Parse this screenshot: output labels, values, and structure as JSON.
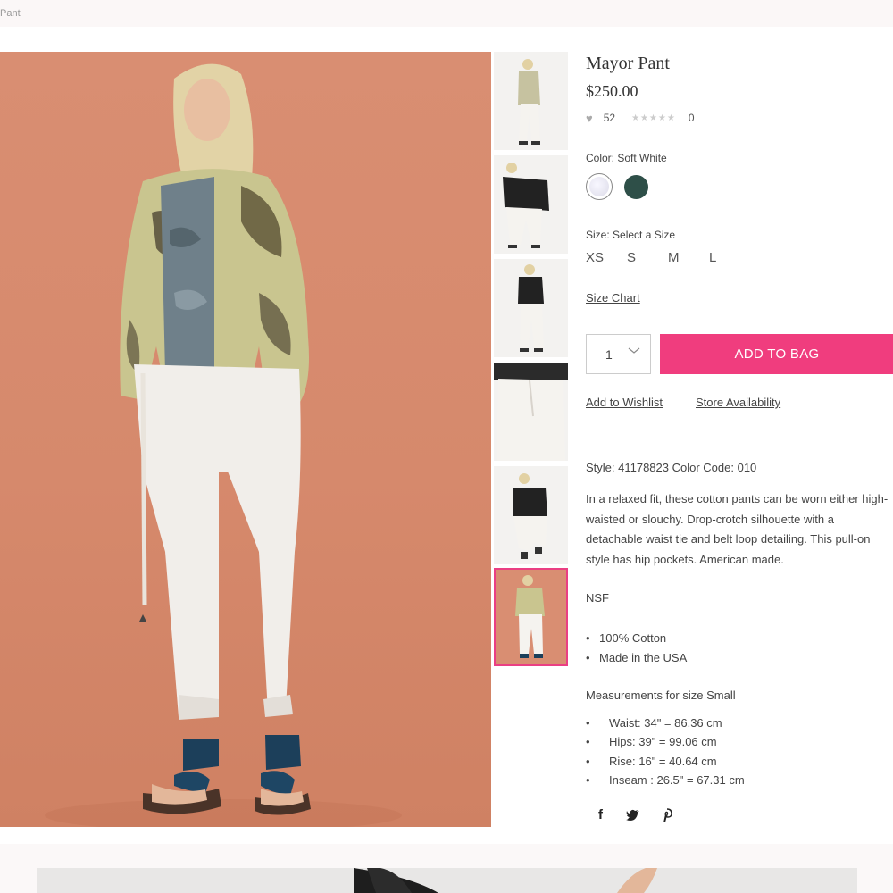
{
  "breadcrumb": "Pant",
  "product": {
    "title": "Mayor Pant",
    "price": "$250.00",
    "likes": "52",
    "rating_count": "0",
    "rating_stars": "★★★★★"
  },
  "color": {
    "label": "Color: Soft White",
    "options": [
      "soft-white",
      "forest-green"
    ]
  },
  "size": {
    "label": "Size: Select a Size",
    "options": [
      "XS",
      "S",
      "M",
      "L"
    ],
    "chart_link": "Size Chart"
  },
  "quantity": {
    "value": "1"
  },
  "actions": {
    "add_to_bag": "ADD TO BAG",
    "wishlist": "Add to Wishlist",
    "store_availability": "Store Availability"
  },
  "details": {
    "style": "Style: 41178823 Color Code: 010",
    "description": "In a relaxed fit, these cotton pants can be worn either high-waisted or slouchy. Drop-crotch silhouette with a detachable waist tie and belt loop detailing. This pull-on style has hip pockets. American made.",
    "brand_code": "NSF",
    "features": [
      "100% Cotton",
      "Made in the USA"
    ],
    "measurements_title": "Measurements for size Small",
    "measurements": [
      "Waist: 34\" = 86.36 cm",
      "Hips: 39\" = 99.06 cm",
      "Rise: 16\" = 40.64 cm",
      "Inseam : 26.5\" = 67.31 cm"
    ]
  },
  "social": {
    "facebook": "f",
    "twitter": "🐦",
    "pinterest": "𝓅"
  },
  "colors": {
    "accent": "#f03d7e",
    "active_thumb_border": "#ea3f83",
    "hero_bg": "#d98e72"
  }
}
